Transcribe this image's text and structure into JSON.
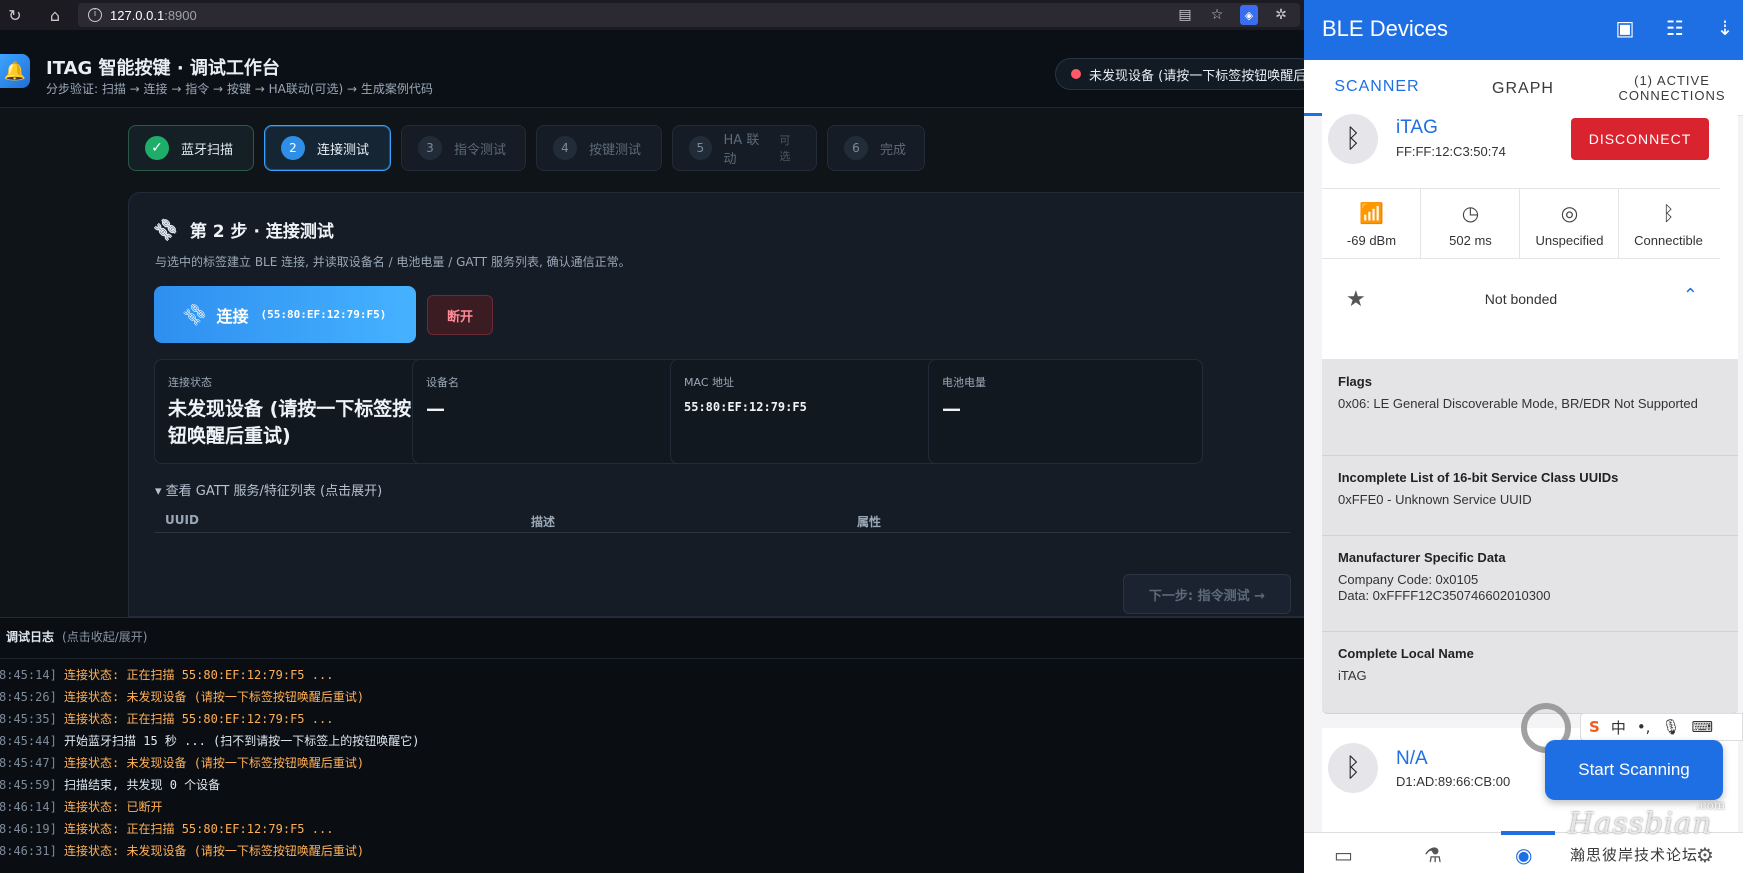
{
  "browser": {
    "url_host": "127.0.0.1",
    "url_port": ":8900"
  },
  "app": {
    "title": "ITAG 智能按键 · 调试工作台",
    "subtitle": "分步验证: 扫描 → 连接 → 指令 → 按键 → HA联动(可选) → 生成案例代码",
    "status": "未发现设备 (请按一下标签按钮唤醒后重试)"
  },
  "steps": [
    {
      "num": "✓",
      "label": "蓝牙扫描",
      "state": "done"
    },
    {
      "num": "2",
      "label": "连接测试",
      "state": "active"
    },
    {
      "num": "3",
      "label": "指令测试",
      "state": "pending"
    },
    {
      "num": "4",
      "label": "按键测试",
      "state": "pending"
    },
    {
      "num": "5",
      "label": "HA 联动",
      "optional": "可选",
      "state": "pending"
    },
    {
      "num": "6",
      "label": "完成",
      "state": "pending"
    }
  ],
  "panel": {
    "title": "第 2 步 · 连接测试",
    "description": "与选中的标签建立 BLE 连接, 并读取设备名 / 电池电量 / GATT 服务列表, 确认通信正常。",
    "connect_label": "连接",
    "connect_mac": "(55:80:EF:12:79:F5)",
    "disconnect_label": "断开",
    "cards": {
      "conn_status_key": "连接状态",
      "conn_status_val": "未发现设备 (请按一下标签按钮唤醒后重试)",
      "device_name_key": "设备名",
      "device_name_val": "—",
      "mac_key": "MAC 地址",
      "mac_val": "55:80:EF:12:79:F5",
      "battery_key": "电池电量",
      "battery_val": "—"
    },
    "gatt_toggle": "▾ 查看 GATT 服务/特征列表 (点击展开)",
    "gatt_columns": [
      "UUID",
      "描述",
      "属性"
    ],
    "next_label": "下一步: 指令测试 →"
  },
  "log": {
    "title": "调试日志",
    "hint": "(点击收起/展开)",
    "lines": [
      {
        "time": "8:45:14]",
        "msg": " 连接状态: 正在扫描 55:80:EF:12:79:F5 ...",
        "type": "warn"
      },
      {
        "time": "8:45:26]",
        "msg": " 连接状态: 未发现设备 (请按一下标签按钮唤醒后重试)",
        "type": "warn"
      },
      {
        "time": "8:45:35]",
        "msg": " 连接状态: 正在扫描 55:80:EF:12:79:F5 ...",
        "type": "warn"
      },
      {
        "time": "8:45:44]",
        "msg": " 开始蓝牙扫描 15 秒 ... (扫不到请按一下标签上的按钮唤醒它)",
        "type": "info"
      },
      {
        "time": "8:45:47]",
        "msg": " 连接状态: 未发现设备 (请按一下标签按钮唤醒后重试)",
        "type": "warn"
      },
      {
        "time": "8:45:59]",
        "msg": " 扫描结束, 共发现 0 个设备",
        "type": "info"
      },
      {
        "time": "8:46:14]",
        "msg": " 连接状态: 已断开",
        "type": "warn"
      },
      {
        "time": "8:46:19]",
        "msg": " 连接状态: 正在扫描 55:80:EF:12:79:F5 ...",
        "type": "warn"
      },
      {
        "time": "8:46:31]",
        "msg": " 连接状态: 未发现设备 (请按一下标签按钮唤醒后重试)",
        "type": "warn"
      }
    ]
  },
  "phone": {
    "title": "BLE Devices",
    "tabs": {
      "scanner": "SCANNER",
      "graph": "GRAPH",
      "active": "(1) ACTIVE CONNECTIONS"
    },
    "device1": {
      "name": "iTAG",
      "mac": "FF:FF:12:C3:50:74",
      "disconnect_label": "DISCONNECT",
      "rssi": "-69 dBm",
      "interval": "502 ms",
      "tx": "Unspecified",
      "connectable": "Connectible",
      "bond": "Not bonded"
    },
    "adv": [
      {
        "title": "Flags",
        "detail": "0x06: LE General Discoverable Mode, BR/EDR Not Supported"
      },
      {
        "title": "Incomplete List of 16-bit Service Class UUIDs",
        "detail": "0xFFE0 - Unknown Service UUID"
      },
      {
        "title": "Manufacturer Specific Data",
        "detail": "Company Code: 0x0105\nData: 0xFFFF12C350746602010300"
      },
      {
        "title": "Complete Local Name",
        "detail": "iTAG"
      }
    ],
    "device2": {
      "name": "N/A",
      "mac": "D1:AD:89:66:CB:00"
    },
    "fab_label": "Start Scanning",
    "watermark_brand": "Hassbian",
    "watermark_dotcom": ".com",
    "watermark_cn": "瀚思彼岸技术论坛"
  },
  "colors": {
    "accent": "#2f8ff0",
    "phone_primary": "#1e6fe3",
    "danger": "#d9232e",
    "log_warn": "#ffb057"
  }
}
